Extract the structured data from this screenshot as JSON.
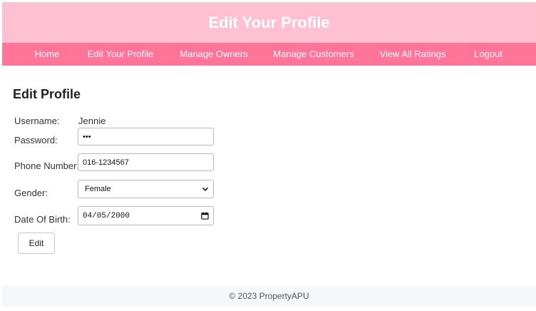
{
  "header": {
    "title": "Edit Your Profile"
  },
  "nav": {
    "items": [
      {
        "label": "Home"
      },
      {
        "label": "Edit Your Profile"
      },
      {
        "label": "Manage Owners"
      },
      {
        "label": "Manage Customers"
      },
      {
        "label": "View All Ratings"
      },
      {
        "label": "Logout"
      }
    ]
  },
  "form": {
    "title": "Edit Profile",
    "username": {
      "label": "Username:",
      "value": "Jennie"
    },
    "password": {
      "label": "Password:",
      "value": "•••"
    },
    "phone": {
      "label": "Phone Number:",
      "value": "016-1234567"
    },
    "gender": {
      "label": "Gender:",
      "value": "Female"
    },
    "dob": {
      "label": "Date Of Birth:",
      "value": "04/05/2000"
    },
    "submit_label": "Edit"
  },
  "footer": {
    "text": "© 2023 PropertyAPU"
  },
  "colors": {
    "header_bg": "#ffc1d1",
    "nav_bg": "#ff7498",
    "footer_bg": "#f6f7fb"
  }
}
